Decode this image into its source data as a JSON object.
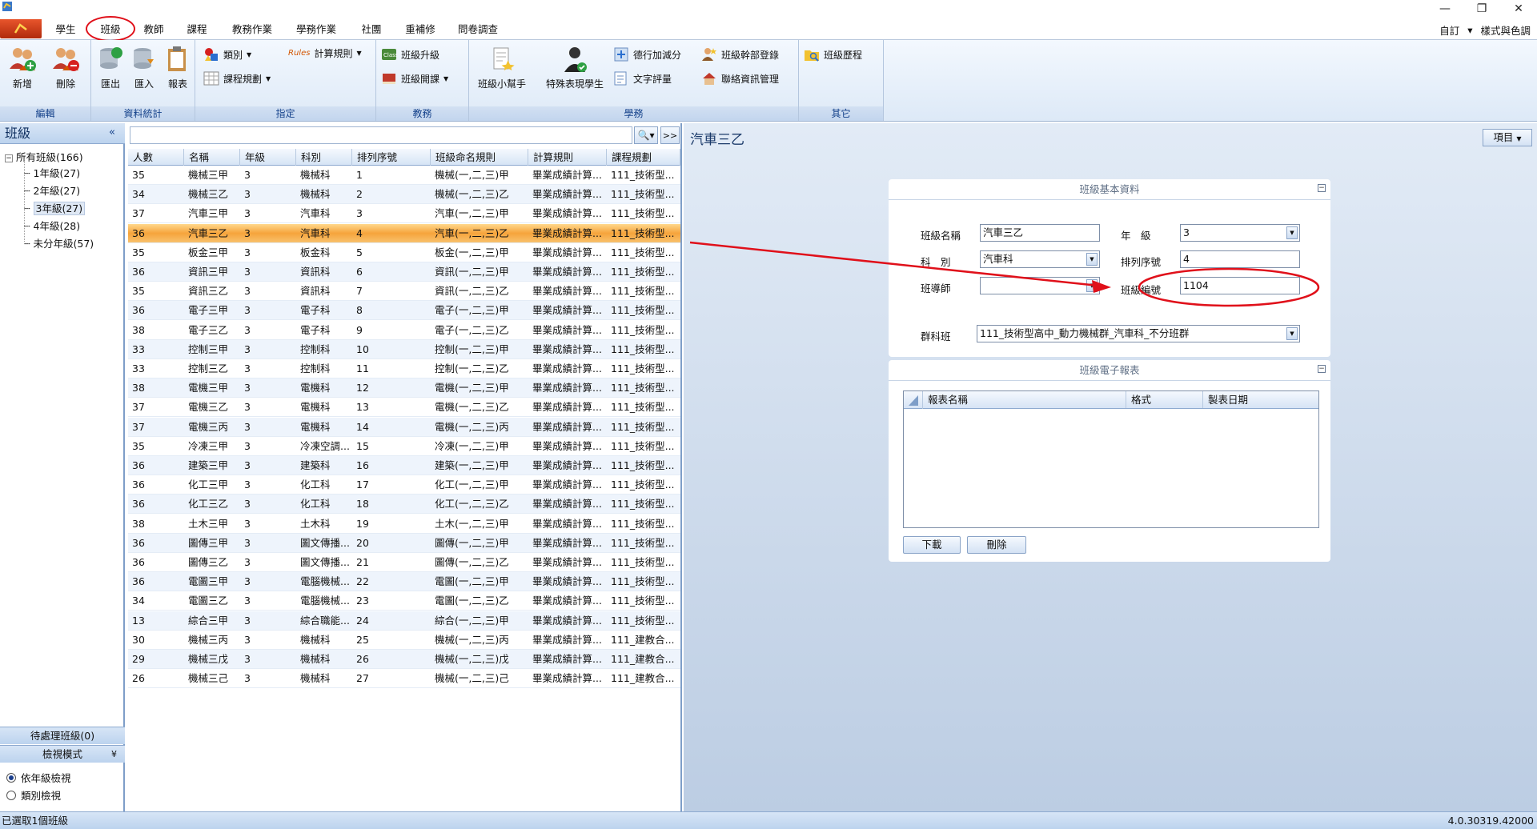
{
  "ribbon_tabs": [
    "學生",
    "班級",
    "教師",
    "課程",
    "教務作業",
    "學務作業",
    "社團",
    "重補修",
    "問卷調查"
  ],
  "tab_right": {
    "custom": "自訂",
    "dropdown_glyph": "▾",
    "style": "樣式與色調"
  },
  "window_controls": {
    "minimize": "—",
    "restore": "❐",
    "close": "✕"
  },
  "ribbon": {
    "edit": {
      "label": "編輯",
      "add": "新增",
      "delete": "刪除"
    },
    "stats": {
      "label": "資料統計",
      "export": "匯出",
      "import": "匯入",
      "report": "報表"
    },
    "assign": {
      "label": "指定",
      "category": "類別",
      "calc_rule": "計算規則",
      "course_plan": "課程規劃",
      "rules_tag": "Rules"
    },
    "academic": {
      "label": "教務",
      "promote": "班級升級",
      "open_class": "班級開課"
    },
    "student_affairs": {
      "label": "學務",
      "helper": "班級小幫手",
      "special": "特殊表現學生",
      "conduct": "德行加減分",
      "text_eval": "文字評量",
      "cadre": "班級幹部登錄",
      "contact": "聯絡資訊管理"
    },
    "other": {
      "label": "其它",
      "history": "班級歷程"
    }
  },
  "left_panel": {
    "title": "班級",
    "collapse_glyph": "«",
    "tree": {
      "root": "所有班級(166)",
      "items": [
        "1年級(27)",
        "2年級(27)",
        "3年級(27)",
        "4年級(28)",
        "未分年級(57)"
      ]
    },
    "pending": "待處理班級(0)",
    "view_mode": "檢視模式",
    "view_mode_glyph": "¥",
    "view_options": [
      "依年級檢視",
      "類別檢視"
    ]
  },
  "grid": {
    "search_glyph": "🔍▾",
    "expand_glyph": ">>",
    "columns": [
      "人數",
      "名稱",
      "年級",
      "科別",
      "排列序號",
      "班級命名規則",
      "計算規則",
      "課程規劃"
    ],
    "rows": [
      [
        "35",
        "機械三甲",
        "3",
        "機械科",
        "1",
        "機械(一,二,三)甲",
        "畢業成績計算...",
        "111_技術型..."
      ],
      [
        "34",
        "機械三乙",
        "3",
        "機械科",
        "2",
        "機械(一,二,三)乙",
        "畢業成績計算...",
        "111_技術型..."
      ],
      [
        "37",
        "汽車三甲",
        "3",
        "汽車科",
        "3",
        "汽車(一,二,三)甲",
        "畢業成績計算...",
        "111_技術型..."
      ],
      [
        "36",
        "汽車三乙",
        "3",
        "汽車科",
        "4",
        "汽車(一,二,三)乙",
        "畢業成績計算...",
        "111_技術型..."
      ],
      [
        "35",
        "板金三甲",
        "3",
        "板金科",
        "5",
        "板金(一,二,三)甲",
        "畢業成績計算...",
        "111_技術型..."
      ],
      [
        "36",
        "資訊三甲",
        "3",
        "資訊科",
        "6",
        "資訊(一,二,三)甲",
        "畢業成績計算...",
        "111_技術型..."
      ],
      [
        "35",
        "資訊三乙",
        "3",
        "資訊科",
        "7",
        "資訊(一,二,三)乙",
        "畢業成績計算...",
        "111_技術型..."
      ],
      [
        "36",
        "電子三甲",
        "3",
        "電子科",
        "8",
        "電子(一,二,三)甲",
        "畢業成績計算...",
        "111_技術型..."
      ],
      [
        "38",
        "電子三乙",
        "3",
        "電子科",
        "9",
        "電子(一,二,三)乙",
        "畢業成績計算...",
        "111_技術型..."
      ],
      [
        "33",
        "控制三甲",
        "3",
        "控制科",
        "10",
        "控制(一,二,三)甲",
        "畢業成績計算...",
        "111_技術型..."
      ],
      [
        "33",
        "控制三乙",
        "3",
        "控制科",
        "11",
        "控制(一,二,三)乙",
        "畢業成績計算...",
        "111_技術型..."
      ],
      [
        "38",
        "電機三甲",
        "3",
        "電機科",
        "12",
        "電機(一,二,三)甲",
        "畢業成績計算...",
        "111_技術型..."
      ],
      [
        "37",
        "電機三乙",
        "3",
        "電機科",
        "13",
        "電機(一,二,三)乙",
        "畢業成績計算...",
        "111_技術型..."
      ],
      [
        "37",
        "電機三丙",
        "3",
        "電機科",
        "14",
        "電機(一,二,三)丙",
        "畢業成績計算...",
        "111_技術型..."
      ],
      [
        "35",
        "冷凍三甲",
        "3",
        "冷凍空調...",
        "15",
        "冷凍(一,二,三)甲",
        "畢業成績計算...",
        "111_技術型..."
      ],
      [
        "36",
        "建築三甲",
        "3",
        "建築科",
        "16",
        "建築(一,二,三)甲",
        "畢業成績計算...",
        "111_技術型..."
      ],
      [
        "36",
        "化工三甲",
        "3",
        "化工科",
        "17",
        "化工(一,二,三)甲",
        "畢業成績計算...",
        "111_技術型..."
      ],
      [
        "36",
        "化工三乙",
        "3",
        "化工科",
        "18",
        "化工(一,二,三)乙",
        "畢業成績計算...",
        "111_技術型..."
      ],
      [
        "38",
        "土木三甲",
        "3",
        "土木科",
        "19",
        "土木(一,二,三)甲",
        "畢業成績計算...",
        "111_技術型..."
      ],
      [
        "36",
        "圖傳三甲",
        "3",
        "圖文傳播...",
        "20",
        "圖傳(一,二,三)甲",
        "畢業成績計算...",
        "111_技術型..."
      ],
      [
        "36",
        "圖傳三乙",
        "3",
        "圖文傳播...",
        "21",
        "圖傳(一,二,三)乙",
        "畢業成績計算...",
        "111_技術型..."
      ],
      [
        "36",
        "電圖三甲",
        "3",
        "電腦機械...",
        "22",
        "電圖(一,二,三)甲",
        "畢業成績計算...",
        "111_技術型..."
      ],
      [
        "34",
        "電圖三乙",
        "3",
        "電腦機械...",
        "23",
        "電圖(一,二,三)乙",
        "畢業成績計算...",
        "111_技術型..."
      ],
      [
        "13",
        "綜合三甲",
        "3",
        "綜合職能...",
        "24",
        "綜合(一,二,三)甲",
        "畢業成績計算...",
        "111_技術型..."
      ],
      [
        "30",
        "機械三丙",
        "3",
        "機械科",
        "25",
        "機械(一,二,三)丙",
        "畢業成績計算...",
        "111_建教合..."
      ],
      [
        "29",
        "機械三戊",
        "3",
        "機械科",
        "26",
        "機械(一,二,三)戊",
        "畢業成績計算...",
        "111_建教合..."
      ],
      [
        "26",
        "機械三己",
        "3",
        "機械科",
        "27",
        "機械(一,二,三)己",
        "畢業成績計算...",
        "111_建教合..."
      ]
    ],
    "selected_row": 3
  },
  "detail": {
    "title": "汽車三乙",
    "items_btn": "項目",
    "basic": {
      "header": "班級基本資料",
      "class_name_label": "班級名稱",
      "class_name": "汽車三乙",
      "grade_label": "年　級",
      "grade": "3",
      "dept_label": "科　別",
      "dept": "汽車科",
      "order_label": "排列序號",
      "order": "4",
      "teacher_label": "班導師",
      "teacher": "",
      "class_no_label": "班級編號",
      "class_no": "1104",
      "group_label": "群科班",
      "group": "111_技術型高中_動力機械群_汽車科_不分班群"
    },
    "reports": {
      "header": "班級電子報表",
      "columns": [
        "報表名稱",
        "格式",
        "製表日期"
      ],
      "download": "下載",
      "delete": "刪除"
    }
  },
  "status": {
    "left": "已選取1個班級",
    "version": "4.0.30319.42000"
  },
  "colors": {
    "highlight": "#e0101a",
    "selected_row": "#f6a43c",
    "ribbon_label": "#15428b"
  }
}
